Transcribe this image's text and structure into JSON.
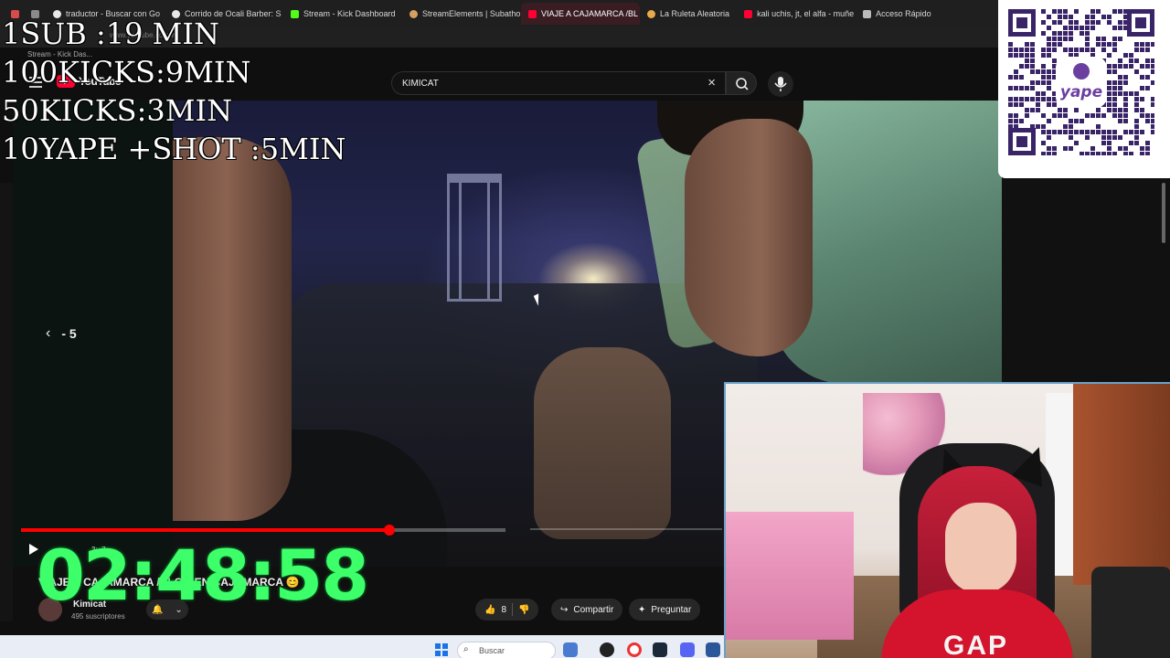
{
  "browser": {
    "tabs": [
      {
        "label": "",
        "color": "#d94a4a"
      },
      {
        "label": "",
        "color": "#8a8a8a"
      },
      {
        "label": "traductor - Buscar con Go",
        "color": "#e8e8e8"
      },
      {
        "label": "Corrido de Ocali Barber: S",
        "color": "#e8e8e8"
      },
      {
        "label": "Stream - Kick Dashboard",
        "color": "#53fc18"
      },
      {
        "label": "StreamElements | Subatho",
        "color": "#d6a060"
      },
      {
        "label": "VIAJE A CAJAMARCA /BL",
        "color": "#ff0033",
        "active": true
      },
      {
        "label": "La Ruleta Aleatoria",
        "color": "#e8a94a"
      },
      {
        "label": "kali uchis, jt, el alfa - muñe",
        "color": "#ff0033"
      },
      {
        "label": "Acceso Rápido",
        "color": "#bbbbbb"
      }
    ],
    "new_tab": "+",
    "url_fragment": "www.youtube.com/w",
    "second_tab": "Stream - Kick Das..."
  },
  "youtube": {
    "logo_text": "YouTube",
    "search_value": "KIMICAT",
    "clear_icon": "×"
  },
  "overlay": {
    "goals": [
      "1SUB :19 MIN",
      "100KICKS:9MIN",
      "50KICKS:3MIN",
      "10YAPE +SHOT :5MIN"
    ],
    "timer": "02:48:58",
    "qr_brand": "yape"
  },
  "player": {
    "seek_back": "- 5",
    "seek_icon": "‹",
    "progress_fraction": 0.76,
    "time_small": "3:..7"
  },
  "video_info": {
    "title": "VIAJE A CAJAMARCA /BLOG EN CAJAMARCA 😊",
    "channel": "Kimicat",
    "subscribers": "495 suscriptores",
    "likes": "8",
    "share_label": "Compartir",
    "ask_label": "Preguntar"
  },
  "webcam": {
    "shirt_text": "GAP"
  },
  "taskbar": {
    "search_placeholder": "Buscar"
  }
}
